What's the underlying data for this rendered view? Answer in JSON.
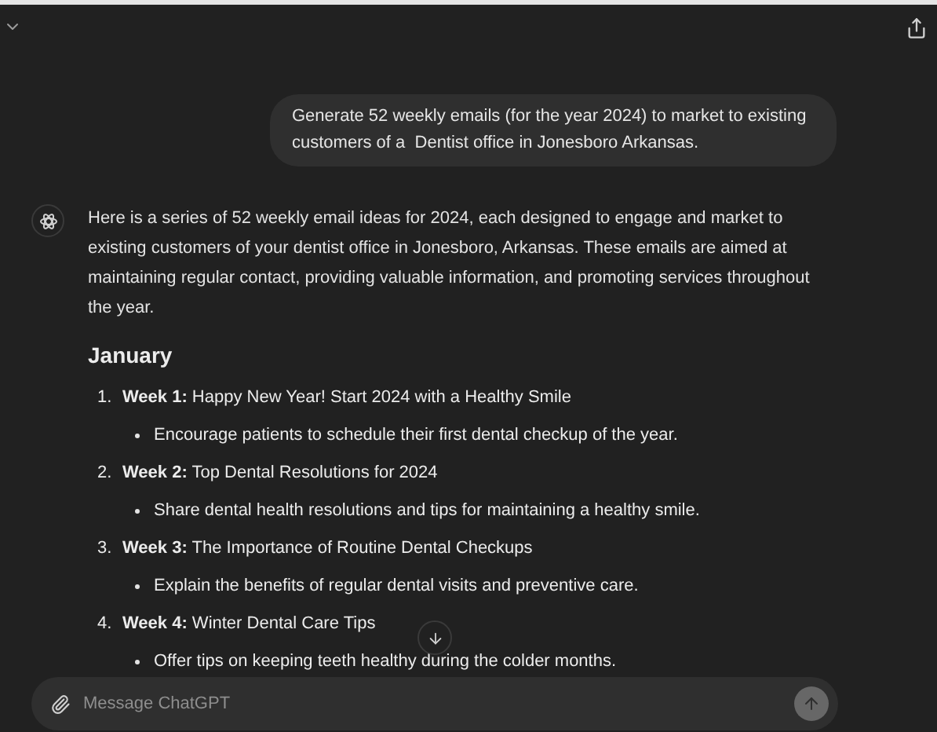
{
  "user_message": "Generate 52 weekly emails (for the year 2024) to market to existing customers of a  Dentist office in Jonesboro Arkansas.",
  "reply": {
    "intro": "Here is a series of 52 weekly email ideas for 2024, each designed to engage and market to existing customers of your dentist office in Jonesboro, Arkansas. These emails are aimed at maintaining regular contact, providing valuable information, and promoting services throughout the year.",
    "heading": "January",
    "items": [
      {
        "number": "1.",
        "title": "**Week 1:** Happy New Year! Start 2024 with a Healthy Smile",
        "bullets": [
          "Encourage patients to schedule their first dental checkup of the year."
        ]
      },
      {
        "number": "2.",
        "title": "**Week 2:** Top Dental Resolutions for 2024",
        "bullets": [
          "Share dental health resolutions and tips for maintaining a healthy smile."
        ]
      },
      {
        "number": "3.",
        "title": "**Week 3:** The Importance of Routine Dental Checkups",
        "bullets": [
          "Explain the benefits of regular dental visits and preventive care."
        ]
      },
      {
        "number": "4.",
        "title": "**Week 4:** Winter Dental Care Tips",
        "bullets": [
          "Offer tips on keeping teeth healthy during the colder months."
        ]
      }
    ]
  },
  "composer": {
    "placeholder": "Message ChatGPT",
    "send_disabled": true
  }
}
